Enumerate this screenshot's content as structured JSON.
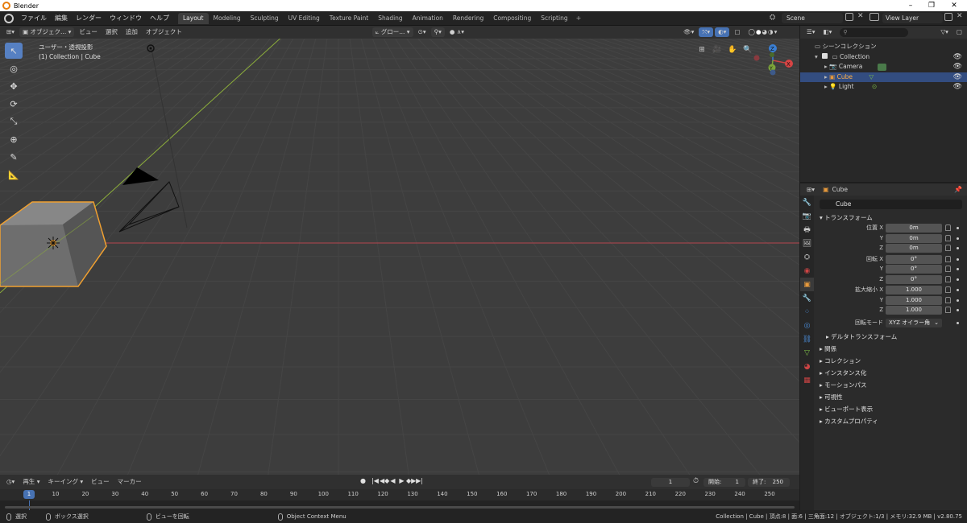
{
  "window": {
    "title": "Blender",
    "controls": [
      "–",
      "❐",
      "✕"
    ]
  },
  "menu": {
    "items": [
      "ファイル",
      "編集",
      "レンダー",
      "ウィンドウ",
      "ヘルプ"
    ]
  },
  "workspaces": {
    "tabs": [
      "Layout",
      "Modeling",
      "Sculpting",
      "UV Editing",
      "Texture Paint",
      "Shading",
      "Animation",
      "Rendering",
      "Compositing",
      "Scripting"
    ],
    "active": "Layout",
    "add": "+"
  },
  "scene": {
    "name": "Scene"
  },
  "view_layer": {
    "name": "View Layer"
  },
  "viewport_header": {
    "mode": "オブジェク...",
    "menus": [
      "ビュー",
      "選択",
      "追加",
      "オブジェクト"
    ],
    "transform_orientation": "グロー..."
  },
  "viewport": {
    "view_name": "ユーザー・透視投影",
    "collection_info": "(1) Collection | Cube",
    "gizmo": {
      "x": "X",
      "y": "Y",
      "z": "Z"
    },
    "colors": {
      "background": "#3d3d3d",
      "selected_outline": "#f0a030",
      "x_axis": "#b5454e",
      "y_axis": "#8cad3b"
    }
  },
  "tools": [
    "select-box-icon",
    "cursor-icon",
    "move-icon",
    "rotate-icon",
    "scale-icon",
    "transform-icon",
    "annotate-icon",
    "measure-icon"
  ],
  "outliner": {
    "root": "シーンコレクション",
    "collection": "Collection",
    "objects": [
      {
        "name": "Camera",
        "selected": false
      },
      {
        "name": "Cube",
        "selected": true
      },
      {
        "name": "Light",
        "selected": false
      }
    ],
    "selected_color": "#334d80"
  },
  "properties": {
    "header_object": "Cube",
    "object_name": "Cube",
    "transform_label": "トランスフォーム",
    "location_label": "位置 X",
    "rotation_label": "回転 X",
    "scale_label": "拡大縮小 X",
    "axis_y": "Y",
    "axis_z": "Z",
    "location": [
      "0m",
      "0m",
      "0m"
    ],
    "rotation": [
      "0°",
      "0°",
      "0°"
    ],
    "scale": [
      "1.000",
      "1.000",
      "1.000"
    ],
    "rotation_mode_label": "回転モード",
    "rotation_mode": "XYZ オイラー角",
    "delta_transform": "デルタトランスフォーム",
    "panels": [
      "関係",
      "コレクション",
      "インスタンス化",
      "モーションパス",
      "可視性",
      "ビューポート表示",
      "カスタムプロパティ"
    ]
  },
  "timeline": {
    "menus": [
      "再生",
      "キーイング",
      "ビュー",
      "マーカー"
    ],
    "current_frame": "1",
    "start_label": "開始:",
    "start": "1",
    "end_label": "終了:",
    "end": "250",
    "ticks": [
      "10",
      "20",
      "30",
      "40",
      "50",
      "60",
      "70",
      "80",
      "90",
      "100",
      "110",
      "120",
      "130",
      "140",
      "150",
      "160",
      "170",
      "180",
      "190",
      "200",
      "210",
      "220",
      "230",
      "240",
      "250"
    ],
    "playback_icons": [
      "●",
      "|◀",
      "◀◆",
      "◀",
      "▶",
      "◆▶",
      "▶|"
    ]
  },
  "statusbar": {
    "hints": [
      "選択",
      "ボックス選択",
      "ビューを回転",
      "Object Context Menu"
    ],
    "stats": "Collection | Cube | 頂点:8 | 面:6 | 三角面:12 | オブジェクト:1/3 | メモリ:32.9 MB | v2.80.75"
  }
}
